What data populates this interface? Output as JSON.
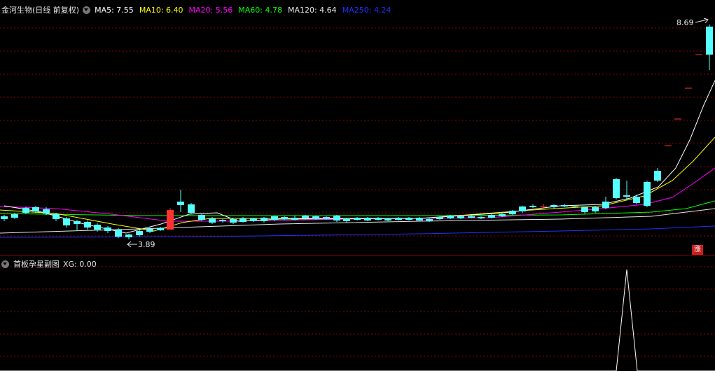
{
  "main_panel": {
    "title": "金河生物(日线 前复权)",
    "indicators": [
      {
        "label": "MA5: 7.55",
        "color": "#ffffff"
      },
      {
        "label": "MA10: 6.40",
        "color": "#ffff00"
      },
      {
        "label": "MA20: 5.56",
        "color": "#ff00ff"
      },
      {
        "label": "MA60: 4.78",
        "color": "#00ff00"
      },
      {
        "label": "MA120: 4.64",
        "color": "#e6e6e6"
      },
      {
        "label": "MA250: 4.24",
        "color": "#1e32ff"
      }
    ],
    "max_label": "8.69",
    "min_label": "3.89",
    "badge": "涨",
    "dropdown_icon": "chevron-down-icon"
  },
  "sub_panel": {
    "title": "首板孕星副图",
    "indicator": "XG: 0.00",
    "dropdown_icon": "chevron-down-icon"
  },
  "colors": {
    "up": "#ff3232",
    "down": "#54ffff",
    "grid": "#8b0000",
    "signal": "#ffffff"
  }
}
